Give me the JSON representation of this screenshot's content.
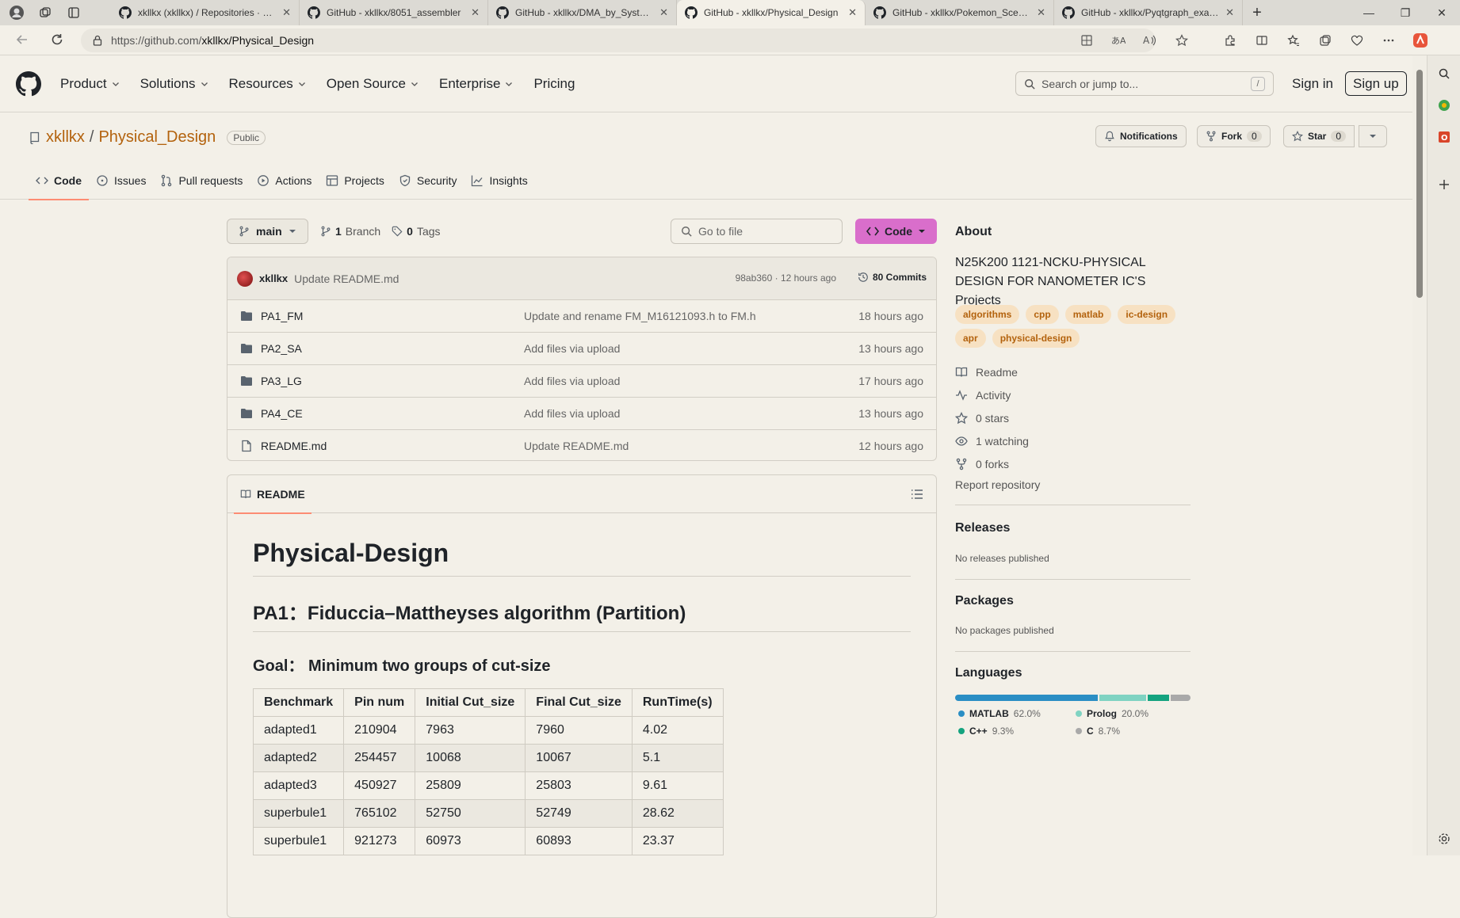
{
  "browser": {
    "tabs": [
      {
        "title": "xkllkx (xkllkx) / Repositories · GitHub",
        "active": false
      },
      {
        "title": "GitHub - xkllkx/8051_assembler",
        "active": false
      },
      {
        "title": "GitHub - xkllkx/DMA_by_SystemC",
        "active": false
      },
      {
        "title": "GitHub - xkllkx/Physical_Design",
        "active": true
      },
      {
        "title": "GitHub - xkllkx/Pokemon_Scenario",
        "active": false
      },
      {
        "title": "GitHub - xkllkx/Pyqtgraph_example",
        "active": false
      }
    ],
    "url_prefix": "https://github.com/",
    "url_path": "xkllkx/Physical_Design"
  },
  "gh_header": {
    "nav": [
      "Product",
      "Solutions",
      "Resources",
      "Open Source",
      "Enterprise",
      "Pricing"
    ],
    "search_placeholder": "Search or jump to...",
    "search_key": "/",
    "signin": "Sign in",
    "signup": "Sign up"
  },
  "repo": {
    "owner": "xkllkx",
    "separator": "/",
    "name": "Physical_Design",
    "visibility": "Public",
    "notifications_label": "Notifications",
    "fork_label": "Fork",
    "fork_count": "0",
    "star_label": "Star",
    "star_count": "0",
    "tabs": [
      "Code",
      "Issues",
      "Pull requests",
      "Actions",
      "Projects",
      "Security",
      "Insights"
    ]
  },
  "toolbar": {
    "branch": "main",
    "branch_count": "1",
    "branch_label": "Branch",
    "tag_count": "0",
    "tag_label": "Tags",
    "goto_placeholder": "Go to file",
    "code_label": "Code"
  },
  "commit": {
    "author": "xkllkx",
    "message": "Update README.md",
    "meta": "98ab360 · 12 hours ago",
    "count_label": "80 Commits"
  },
  "files": [
    {
      "name": "PA1_FM",
      "type": "dir",
      "message": "Update and rename FM_M16121093.h to FM.h",
      "age": "18 hours ago"
    },
    {
      "name": "PA2_SA",
      "type": "dir",
      "message": "Add files via upload",
      "age": "13 hours ago"
    },
    {
      "name": "PA3_LG",
      "type": "dir",
      "message": "Add files via upload",
      "age": "17 hours ago"
    },
    {
      "name": "PA4_CE",
      "type": "dir",
      "message": "Add files via upload",
      "age": "13 hours ago"
    },
    {
      "name": "README.md",
      "type": "file",
      "message": "Update README.md",
      "age": "12 hours ago"
    }
  ],
  "readme": {
    "tab_label": "README",
    "h1": "Physical-Design",
    "h2": "PA1：Fiduccia–Mattheyses algorithm (Partition)",
    "h3": "Goal： Minimum two groups of cut-size",
    "table": {
      "headers": [
        "Benchmark",
        "Pin num",
        "Initial Cut_size",
        "Final Cut_size",
        "RunTime(s)"
      ],
      "rows": [
        [
          "adapted1",
          "210904",
          "7963",
          "7960",
          "4.02"
        ],
        [
          "adapted2",
          "254457",
          "10068",
          "10067",
          "5.1"
        ],
        [
          "adapted3",
          "450927",
          "25809",
          "25803",
          "9.61"
        ],
        [
          "superbule1",
          "765102",
          "52750",
          "52749",
          "28.62"
        ],
        [
          "superbule1",
          "921273",
          "60973",
          "60893",
          "23.37"
        ]
      ]
    }
  },
  "about": {
    "title": "About",
    "description": "N25K200 1121-NCKU-PHYSICAL DESIGN FOR NANOMETER IC'S Projects",
    "topics": [
      "algorithms",
      "cpp",
      "matlab",
      "ic-design",
      "apr",
      "physical-design"
    ],
    "links": [
      {
        "icon": "book-icon",
        "label": "Readme"
      },
      {
        "icon": "pulse-icon",
        "label": "Activity"
      },
      {
        "icon": "star-icon",
        "label": "0 stars"
      },
      {
        "icon": "eye-icon",
        "label": "1 watching"
      },
      {
        "icon": "fork-icon",
        "label": "0 forks"
      }
    ],
    "report": "Report repository",
    "releases_title": "Releases",
    "releases_text": "No releases published",
    "packages_title": "Packages",
    "packages_text": "No packages published",
    "languages_title": "Languages",
    "languages": [
      {
        "name": "MATLAB",
        "pct": "62.0%",
        "value": 62.0,
        "color": "#2a8ec4"
      },
      {
        "name": "Prolog",
        "pct": "20.0%",
        "value": 20.0,
        "color": "#7fd3c2"
      },
      {
        "name": "C++",
        "pct": "9.3%",
        "value": 9.3,
        "color": "#14a37f"
      },
      {
        "name": "C",
        "pct": "8.7%",
        "value": 8.7,
        "color": "#a9a9a9"
      }
    ]
  },
  "colors": {
    "accent": "#b3620d",
    "code_button": "#d96ecb",
    "tab_underline": "#fd8c73"
  }
}
